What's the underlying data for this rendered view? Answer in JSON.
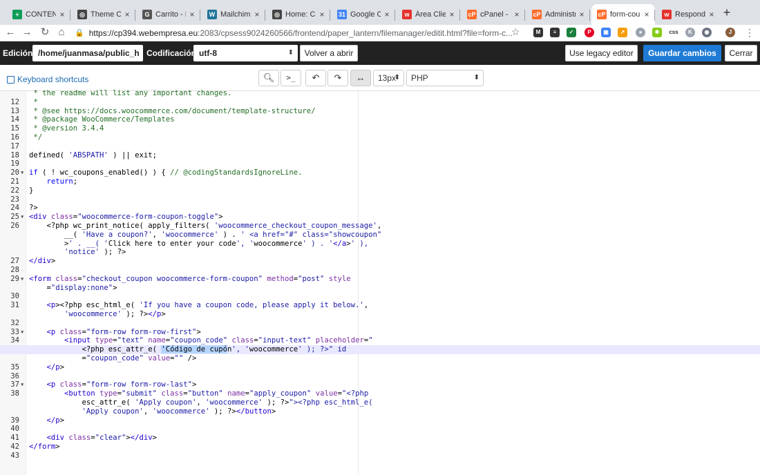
{
  "browser": {
    "tabs": [
      {
        "title": "CONTENID",
        "favicon_color": "#0f9d58",
        "favicon_glyph": "+"
      },
      {
        "title": "Theme Op",
        "favicon_color": "#444444",
        "favicon_glyph": "◎"
      },
      {
        "title": "Carrito - E",
        "favicon_color": "#555555",
        "favicon_glyph": "G"
      },
      {
        "title": "Mailchimp",
        "favicon_color": "#21759b",
        "favicon_glyph": "W"
      },
      {
        "title": "Home: Cla",
        "favicon_color": "#444444",
        "favicon_glyph": "◎"
      },
      {
        "title": "Google Ca",
        "favicon_color": "#4285f4",
        "favicon_glyph": "31"
      },
      {
        "title": "Área Clien",
        "favicon_color": "#e5322d",
        "favicon_glyph": "w"
      },
      {
        "title": "cPanel - P",
        "favicon_color": "#ff6c2c",
        "favicon_glyph": "cP"
      },
      {
        "title": "Administra",
        "favicon_color": "#ff6c2c",
        "favicon_glyph": "cP"
      },
      {
        "title": "form-coup",
        "favicon_color": "#ff6c2c",
        "favicon_glyph": "cP"
      },
      {
        "title": "Responde",
        "favicon_color": "#e5322d",
        "favicon_glyph": "w"
      }
    ],
    "active_tab_index": 9,
    "url_host": "https://cp394.webempresa.eu",
    "url_path": ":2083/cpsess9024260566/frontend/paper_lantern/filemanager/editit.html?file=form-c..."
  },
  "editor_bar": {
    "edicion_label": "Edición:",
    "path_value": "/home/juanmasa/public_h",
    "codificacion_label": "Codificación:",
    "encoding_value": "utf-8",
    "reopen_label": "Volver a abrir",
    "legacy_label": "Use legacy editor",
    "save_label": "Guardar cambios",
    "close_label": "Cerrar"
  },
  "subbar": {
    "shortcuts_label": "Keyboard shortcuts",
    "font_size": "13px",
    "mode": "PHP"
  },
  "code_lines": [
    {
      "n": "",
      "fold": "",
      "text": " * the readme will list any important changes."
    },
    {
      "n": "12",
      "fold": "",
      "text": " *"
    },
    {
      "n": "13",
      "fold": "",
      "text": " * @see https://docs.woocommerce.com/document/template-structure/"
    },
    {
      "n": "14",
      "fold": "",
      "text": " * @package WooCommerce/Templates"
    },
    {
      "n": "15",
      "fold": "",
      "text": " * @version 3.4.4"
    },
    {
      "n": "16",
      "fold": "",
      "text": " */"
    },
    {
      "n": "17",
      "fold": "",
      "text": ""
    },
    {
      "n": "18",
      "fold": "",
      "text": "defined( 'ABSPATH' ) || exit;"
    },
    {
      "n": "19",
      "fold": "",
      "text": ""
    },
    {
      "n": "20",
      "fold": "▾",
      "text": "if ( ! wc_coupons_enabled() ) { // @codingStandardsIgnoreLine."
    },
    {
      "n": "21",
      "fold": "",
      "text": "    return;"
    },
    {
      "n": "22",
      "fold": "",
      "text": "}"
    },
    {
      "n": "23",
      "fold": "",
      "text": ""
    },
    {
      "n": "24",
      "fold": "",
      "text": "?>"
    },
    {
      "n": "25",
      "fold": "▾",
      "text": "<div class=\"woocommerce-form-coupon-toggle\">"
    },
    {
      "n": "26",
      "fold": "",
      "text": "    <?php wc_print_notice( apply_filters( 'woocommerce_checkout_coupon_message',"
    },
    {
      "n": "",
      "fold": "",
      "text": "        __( 'Have a coupon?', 'woocommerce' ) . ' <a href=\"#\" class=\"showcoupon\""
    },
    {
      "n": "",
      "fold": "",
      "text": "        >' . __( 'Click here to enter your code', 'woocommerce' ) . '</a>' ),"
    },
    {
      "n": "",
      "fold": "",
      "text": "        'notice' ); ?>"
    },
    {
      "n": "27",
      "fold": "",
      "text": "</div>"
    },
    {
      "n": "28",
      "fold": "",
      "text": ""
    },
    {
      "n": "29",
      "fold": "▾",
      "text": "<form class=\"checkout_coupon woocommerce-form-coupon\" method=\"post\" style"
    },
    {
      "n": "",
      "fold": "",
      "text": "    =\"display:none\">"
    },
    {
      "n": "30",
      "fold": "",
      "text": ""
    },
    {
      "n": "31",
      "fold": "",
      "text": "    <p><?php esc_html_e( 'If you have a coupon code, please apply it below.',"
    },
    {
      "n": "",
      "fold": "",
      "text": "        'woocommerce' ); ?></p>"
    },
    {
      "n": "32",
      "fold": "",
      "text": ""
    },
    {
      "n": "33",
      "fold": "▾",
      "text": "    <p class=\"form-row form-row-first\">"
    },
    {
      "n": "34",
      "fold": "",
      "text": "        <input type=\"text\" name=\"coupon_code\" class=\"input-text\" placeholder=\""
    },
    {
      "n": "",
      "fold": "",
      "text": "            <?php esc_attr_e( 'Código de cupón', 'woocommerce' ); ?>\" id",
      "active": true,
      "sel_start": 30,
      "sel_end": 45
    },
    {
      "n": "",
      "fold": "",
      "text": "            =\"coupon_code\" value=\"\" />"
    },
    {
      "n": "35",
      "fold": "",
      "text": "    </p>"
    },
    {
      "n": "36",
      "fold": "",
      "text": ""
    },
    {
      "n": "37",
      "fold": "▾",
      "text": "    <p class=\"form-row form-row-last\">"
    },
    {
      "n": "38",
      "fold": "",
      "text": "        <button type=\"submit\" class=\"button\" name=\"apply_coupon\" value=\"<?php"
    },
    {
      "n": "",
      "fold": "",
      "text": "            esc_attr_e( 'Apply coupon', 'woocommerce' ); ?>\"><?php esc_html_e("
    },
    {
      "n": "",
      "fold": "",
      "text": "            'Apply coupon', 'woocommerce' ); ?></button>"
    },
    {
      "n": "39",
      "fold": "",
      "text": "    </p>"
    },
    {
      "n": "40",
      "fold": "",
      "text": ""
    },
    {
      "n": "41",
      "fold": "",
      "text": "    <div class=\"clear\"></div>"
    },
    {
      "n": "42",
      "fold": "",
      "text": "</form>"
    },
    {
      "n": "43",
      "fold": "",
      "text": ""
    }
  ]
}
